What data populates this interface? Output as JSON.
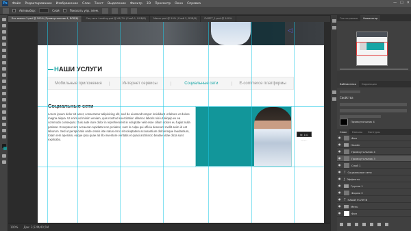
{
  "app": {
    "logo": "Ps"
  },
  "menu": [
    "Файл",
    "Редактирование",
    "Изображение",
    "Слои",
    "Текст",
    "Выделение",
    "Фильтр",
    "3D",
    "Просмотр",
    "Окно",
    "Справка"
  ],
  "window_controls": [
    "—",
    "□",
    "✕"
  ],
  "options_bar": {
    "option_a": "Автовыбор:",
    "option_b": "Слой",
    "option_c": "Показать упр. элем."
  },
  "doc_tabs": [
    {
      "label": "Без имени-1.psd @ 100% (Прямоугольник 4, RGB/8)",
      "active": true
    },
    {
      "label": "Соц.сети Landing.psd @ 66,7% (Слой 1, RGB/8)",
      "active": false
    },
    {
      "label": "Макет.psd @ 50% (Слой 3, RGB/8)",
      "active": false
    },
    {
      "label": "ПАЛЕТ_1.psd @ 100%",
      "active": false
    }
  ],
  "page": {
    "section_title_first": "Н",
    "section_title_rest": "АШИ УСЛУГИ",
    "tabs": [
      {
        "label": "Мобильные приложения",
        "active": false
      },
      {
        "label": "Интернет сервисы",
        "active": false
      },
      {
        "label": "Социальные сети",
        "active": true
      },
      {
        "label": "E-commerce платформы",
        "active": false
      }
    ],
    "content_title": "Социальные сети",
    "content_body": "Lorem ipsum dolor sit amet, consectetur adipisicing elit, sed do eiusmod tempor incididunt ut labore et dolore magna aliqua. Ut enim ad minim veniam, quis nostrud exercitation ullamco laboris nisi ut aliquip ex ea commodo consequat. Duis aute irure dolor in reprehenderit in voluptate velit esse cillum dolore eu fugiat nulla pariatur. Excepteur sint occaecat cupidatat non proident, sunt in culpa qui officia deserunt mollit anim id est laborum. Sed ut perspiciatis unde omnis iste natus error sit voluptatem accusantium doloremque laudantium, totam rem aperiam, eaque ipsa quae ab illo inventore veritatis et quasi architecto beatae vitae dicta sunt explicabo.",
    "tooltip": "W: 141 пикс."
  },
  "status": {
    "zoom": "100%",
    "doc": "Док: 3,52M/40,5M"
  },
  "panels": {
    "top_tabs": [
      "Гистограмма",
      "Навигатор"
    ],
    "props_tabs": [
      "Библиотеки",
      "Коррекция"
    ],
    "layers_tabs": [
      "Слои",
      "Каналы",
      "Контуры"
    ],
    "props_title": "Свойства",
    "props_text": "Прямоугольник 4",
    "layers": [
      {
        "name": "Фон",
        "type": "layer",
        "selected": false
      },
      {
        "name": "Header",
        "type": "folder",
        "selected": false
      },
      {
        "name": "Прямоугольник 4",
        "type": "layer",
        "selected": false
      },
      {
        "name": "Прямоугольник 3",
        "type": "layer",
        "selected": true
      },
      {
        "name": "Слой 1",
        "type": "layer",
        "selected": false
      },
      {
        "name": "Социальные сети",
        "type": "text",
        "selected": false
      },
      {
        "name": "Эффекты",
        "type": "fx",
        "selected": false
      },
      {
        "name": "Группа 1",
        "type": "folder",
        "selected": false
      },
      {
        "name": "Форма 2",
        "type": "layer",
        "selected": false
      },
      {
        "name": "НАШИ УСЛУГИ",
        "type": "text",
        "selected": false
      },
      {
        "name": "Menu",
        "type": "folder",
        "selected": false
      },
      {
        "name": "Фон",
        "type": "layer",
        "selected": false
      }
    ]
  },
  "colors": {
    "accent": "#17a5a5",
    "photo_bg": "#12969a",
    "guide": "#1ec8e6"
  }
}
